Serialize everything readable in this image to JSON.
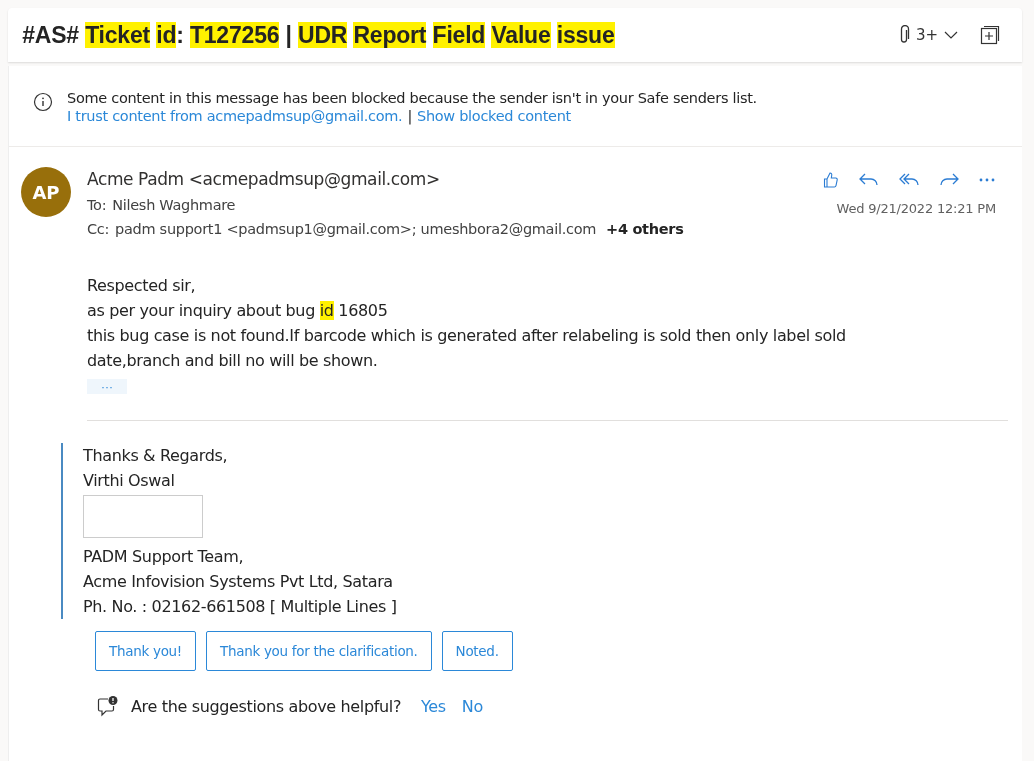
{
  "subject": {
    "segments": [
      {
        "text": "#AS#",
        "highlighted": false,
        "attached": false
      },
      {
        "text": "Ticket",
        "highlighted": true,
        "attached": false
      },
      {
        "text": "id",
        "highlighted": true,
        "attached": false
      },
      {
        "text": ":",
        "highlighted": false,
        "attached": true
      },
      {
        "text": "T127256",
        "highlighted": true,
        "attached": false
      },
      {
        "text": "|",
        "highlighted": false,
        "attached": false
      },
      {
        "text": "UDR",
        "highlighted": true,
        "attached": false
      },
      {
        "text": "Report",
        "highlighted": true,
        "attached": false
      },
      {
        "text": "Field",
        "highlighted": true,
        "attached": false
      },
      {
        "text": "Value",
        "highlighted": true,
        "attached": false
      },
      {
        "text": "issue",
        "highlighted": true,
        "attached": false
      }
    ],
    "attachment_count": "3+"
  },
  "notice": {
    "message": "Some content in this message has been blocked because the sender isn't in your Safe senders list.",
    "trust_link": "I trust content from acmepadmsup@gmail.com.",
    "separator": "|",
    "show_link": "Show blocked content"
  },
  "message": {
    "avatar_initials": "AP",
    "from": "Acme Padm <acmepadmsup@gmail.com>",
    "to_label": "To:",
    "to": "Nilesh Waghmare",
    "cc_label": "Cc:",
    "cc": "padm support1 <padmsup1@gmail.com>;  umeshbora2@gmail.com",
    "cc_more": "+4 others",
    "date": "Wed 9/21/2022 12:21 PM",
    "body": [
      {
        "segments": [
          {
            "text": "Respected sir,",
            "highlighted": false
          }
        ]
      },
      {
        "segments": [
          {
            "text": "as per your inquiry about bug ",
            "highlighted": false
          },
          {
            "text": "id",
            "highlighted": true
          },
          {
            "text": " 16805",
            "highlighted": false
          }
        ]
      },
      {
        "segments": [
          {
            "text": "this bug case is not found.If barcode which is generated after relabeling is sold then only label sold date,branch and bill no will be shown.",
            "highlighted": false
          }
        ]
      }
    ],
    "expand_label": "···",
    "signature": [
      "Thanks & Regards,",
      "Virthi Oswal"
    ],
    "signature_after": [
      "PADM Support Team,",
      "Acme Infovision Systems Pvt Ltd, Satara",
      "Ph. No. : 02162-661508 [ Multiple Lines ]"
    ]
  },
  "quick_replies": [
    "Thank you!",
    "Thank you for the clarification.",
    "Noted."
  ],
  "feedback": {
    "question": "Are the suggestions above helpful?",
    "yes": "Yes",
    "no": "No"
  }
}
